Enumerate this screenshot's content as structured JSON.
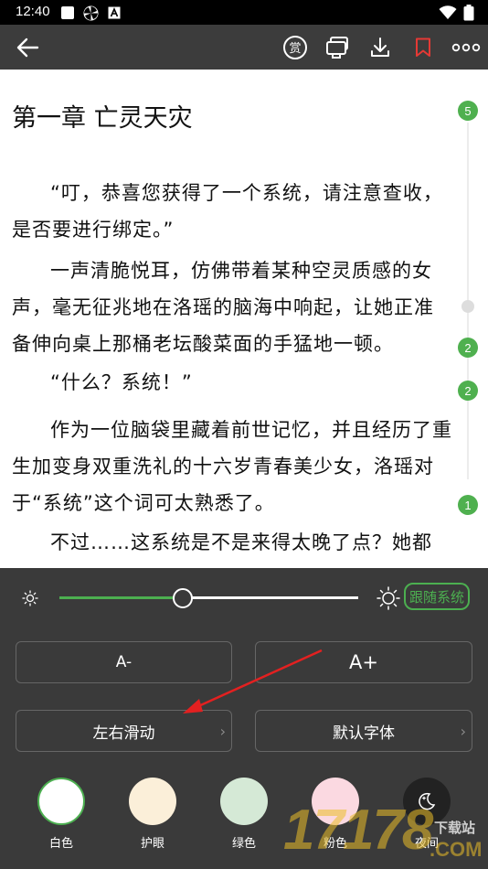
{
  "status_bar": {
    "time": "12:40"
  },
  "toolbar": {
    "icons": [
      "back-arrow-icon",
      "reward-icon",
      "screen-icon",
      "download-icon",
      "bookmark-icon",
      "more-icon"
    ],
    "reward_glyph": "赏"
  },
  "chapter": {
    "title": "第一章 亡灵天灾",
    "paragraphs": [
      "“叮，恭喜您获得了一个系统，请注意查收，是否要进行绑定。”",
      "一声清脆悦耳，仿佛带着某种空灵质感的女声，毫无征兆地在洛瑶的脑海中响起，让她正准备伸向桌上那桶老坛酸菜面的手猛地一顿。",
      "“什么？系统！”",
      "作为一位脑袋里藏着前世记忆，并且经历了重生加变身双重洗礼的十六岁青春美少女，洛瑶对于“系统”这个词可太熟悉了。",
      "不过……这系统是不是来得太晚了点？她都"
    ]
  },
  "comment_badges": [
    "5",
    "2",
    "2",
    "1"
  ],
  "settings_panel": {
    "brightness": {
      "value_fraction": 0.41,
      "follow_system_label": "跟随系统"
    },
    "font_smaller_label": "A-",
    "font_larger_label": "A+",
    "page_mode_label": "左右滑动",
    "font_family_label": "默认字体",
    "chevron": "›",
    "themes": [
      {
        "label": "白色",
        "color": "#ffffff",
        "selected": true
      },
      {
        "label": "护眼",
        "color": "#fbefd9",
        "selected": false
      },
      {
        "label": "绿色",
        "color": "#d5e9d6",
        "selected": false
      },
      {
        "label": "粉色",
        "color": "#fbd9e1",
        "selected": false
      },
      {
        "label": "夜间",
        "color": "#222222",
        "selected": false
      }
    ]
  },
  "colors": {
    "accent": "#4caf50",
    "toolbar": "#3c3c3c",
    "panel": "#3a3a3a",
    "bookmark": "#e53935",
    "arrow": "#e32020"
  },
  "watermark": {
    "number": "17178",
    "site": "下载站",
    "domain": ".COM"
  }
}
